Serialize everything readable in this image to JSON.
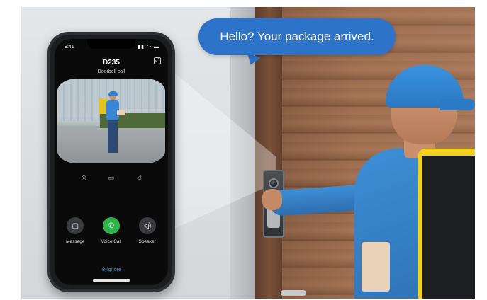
{
  "speech_bubble": {
    "text": "Hello? Your package arrived."
  },
  "phone": {
    "status_time": "9:41",
    "status_icons": "▮▮ ◠ ▬",
    "device_name": "D235",
    "call_type": "Doorbell call",
    "controls": [
      {
        "name": "snapshot-icon",
        "glyph": "◎"
      },
      {
        "name": "record-icon",
        "glyph": "▭"
      },
      {
        "name": "volume-icon",
        "glyph": "◁"
      }
    ],
    "actions": [
      {
        "label": "Message",
        "icon": "message-icon",
        "glyph": "▢"
      },
      {
        "label": "Voice Call",
        "icon": "phone-icon",
        "glyph": "✆"
      },
      {
        "label": "Speaker",
        "icon": "speaker-icon",
        "glyph": "◁)"
      }
    ],
    "ignore_label": "Ignore",
    "ignore_icon": "⊘"
  },
  "colors": {
    "bubble": "#2c73c9",
    "voice_call": "#2fb34a",
    "ignore": "#3e9ae6"
  }
}
